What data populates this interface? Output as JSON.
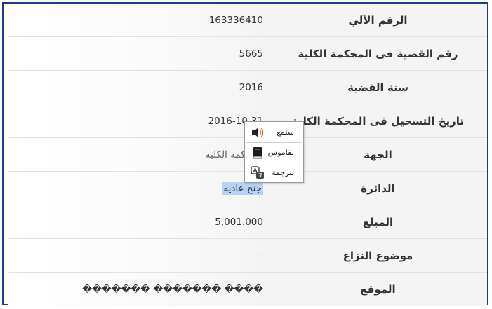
{
  "fields": [
    {
      "label": "الرقم الآلي",
      "value": "163336410"
    },
    {
      "label": "رقم القضية فى المحكمة الكلية",
      "value": "5665"
    },
    {
      "label": "سنة القضية",
      "value": "2016"
    },
    {
      "label": "تاريخ التسجيل فى المحكمة الكلية",
      "value": "2016-10-31"
    },
    {
      "label": "الجهة",
      "value": "المحكمة الكلية"
    },
    {
      "label": "الدائرة",
      "value": "جنح عاديه"
    },
    {
      "label": "المبلغ",
      "value": "5,001.000"
    },
    {
      "label": "موضوع النزاع",
      "value": "-"
    },
    {
      "label": "الموقع",
      "value": "������� ������� ����"
    }
  ],
  "context_menu": {
    "items": [
      {
        "label": "استمع",
        "icon": "speaker-icon"
      },
      {
        "label": "القاموس",
        "icon": "dictionary-book-icon"
      },
      {
        "label": "الترجمة",
        "icon": "translate-icon"
      }
    ]
  },
  "colors": {
    "frame_border": "#1e3a8a",
    "label_background": "#f4f4f4",
    "selection_highlight": "#b9d3f5"
  }
}
